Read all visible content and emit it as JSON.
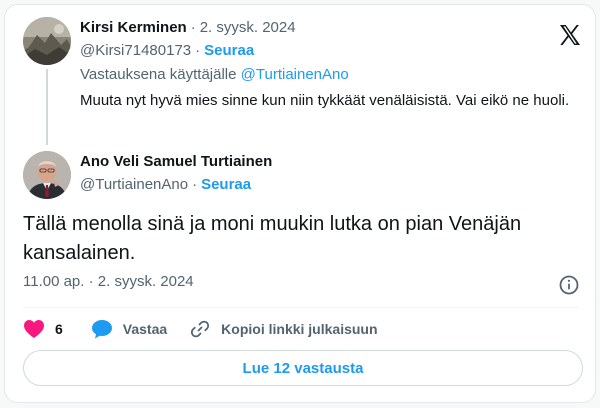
{
  "colors": {
    "accent": "#1d9bf0",
    "text": "#0f1419",
    "muted": "#536471",
    "like": "#f91880",
    "border": "#cfd9de"
  },
  "parent": {
    "author_name": "Kirsi Kerminen",
    "date": "2. syysk. 2024",
    "handle": "@Kirsi71480173",
    "follow_label": "Seuraa",
    "reply_prefix": "Vastauksena käyttäjälle",
    "reply_to": "@TurtiainenAno",
    "text": "Muuta nyt hyvä mies sinne kun niin tykkäät venäläisistä. Vai eikö ne huoli."
  },
  "tweet": {
    "author_name": "Ano Veli Samuel Turtiainen",
    "handle": "@TurtiainenAno",
    "follow_label": "Seuraa",
    "text": "Tällä menolla sinä ja moni muukin lutka on pian Venäjän kansalainen.",
    "timestamp": "11.00 ap. · 2. syysk. 2024"
  },
  "actions": {
    "like_count": "6",
    "reply_label": "Vastaa",
    "copy_label": "Kopioi linkki julkaisuun"
  },
  "read_replies_label": "Lue 12 vastausta",
  "separator": "·",
  "icons": {
    "logo": "x-logo-icon",
    "info": "info-icon",
    "like": "heart-icon",
    "reply": "speech-bubble-icon",
    "copy": "link-icon"
  }
}
